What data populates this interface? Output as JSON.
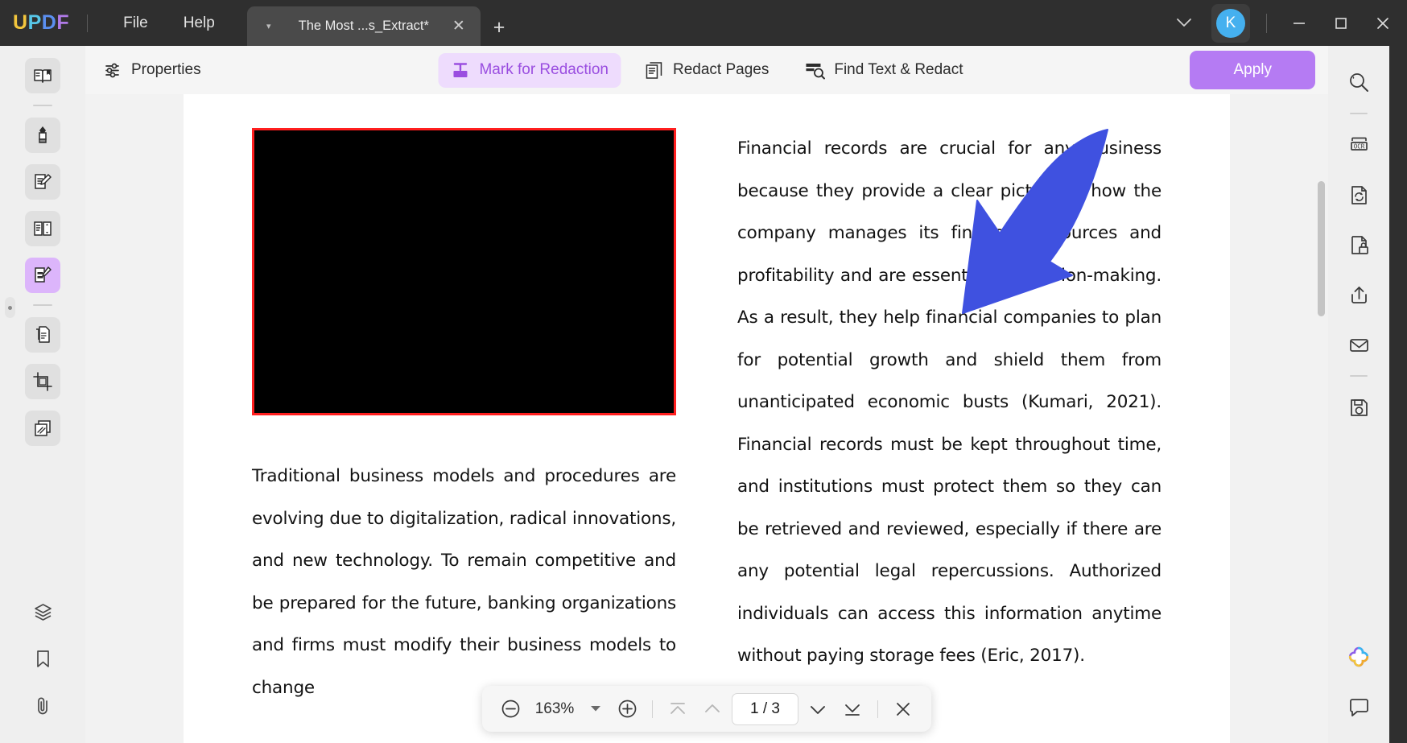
{
  "app": {
    "logo_letters": [
      {
        "ch": "U",
        "color": "#f2c53d"
      },
      {
        "ch": "P",
        "color": "#57c7e8"
      },
      {
        "ch": "D",
        "color": "#5b8ff0"
      },
      {
        "ch": "F",
        "color": "#b07ae8"
      }
    ],
    "accent": "#b57bf3",
    "redaction_accent": "#9a4ee0"
  },
  "titlebar": {
    "menus": [
      {
        "label": "File",
        "name": "menu-file"
      },
      {
        "label": "Help",
        "name": "menu-help"
      }
    ],
    "tab": {
      "title": "The Most ...s_Extract*",
      "caret": "▾",
      "close": "✕"
    },
    "new_tab": "+",
    "chevron_down": "⌄",
    "avatar_initial": "K",
    "window_controls": {
      "minimize": "—",
      "maximize": "▢",
      "close": "✕"
    }
  },
  "left_rail": {
    "items": [
      {
        "name": "sidebar-reader-icon",
        "icon": "book-reader-icon",
        "boxed": true,
        "active": false
      },
      {
        "name": "sidebar-annotate-icon",
        "icon": "highlighter-pen-icon",
        "boxed": true,
        "active": false
      },
      {
        "name": "sidebar-edit-pdf-icon",
        "icon": "edit-document-icon",
        "boxed": true,
        "active": false
      },
      {
        "name": "sidebar-organize-pages-icon",
        "icon": "organize-pages-icon",
        "boxed": true,
        "active": false
      },
      {
        "name": "sidebar-redact-icon",
        "icon": "redact-document-icon",
        "boxed": false,
        "active": true
      },
      {
        "name": "sidebar-compare-icon",
        "icon": "compare-documents-icon",
        "boxed": true,
        "active": false
      },
      {
        "name": "sidebar-crop-icon",
        "icon": "crop-page-icon",
        "boxed": true,
        "active": false
      },
      {
        "name": "sidebar-batch-icon",
        "icon": "batch-process-icon",
        "boxed": true,
        "active": false
      }
    ],
    "bottom_items": [
      {
        "name": "sidebar-layers-icon",
        "icon": "layers-icon"
      },
      {
        "name": "sidebar-bookmarks-icon",
        "icon": "bookmark-icon"
      },
      {
        "name": "sidebar-attachments-icon",
        "icon": "attachment-clip-icon"
      }
    ]
  },
  "toolbar": {
    "properties_label": "Properties",
    "properties_icon": "sliders-settings-icon",
    "center_tools": [
      {
        "label": "Mark for Redaction",
        "name": "tool-mark-for-redaction",
        "icon": "redaction-text-icon",
        "selected": true
      },
      {
        "label": "Redact Pages",
        "name": "tool-redact-pages",
        "icon": "pages-stack-icon",
        "selected": false
      },
      {
        "label": "Find Text & Redact",
        "name": "tool-find-text-and-redact",
        "icon": "find-text-search-icon",
        "selected": false
      }
    ],
    "apply_label": "Apply"
  },
  "document": {
    "redaction_block_label": "redacted-content-block",
    "left_column_paragraph": "Traditional business models and procedures are evolving due to digitalization, radical innovations, and new technology. To remain competitive and be prepared for the future, banking organizations and firms must modify their business models to change",
    "right_column_paragraph": "Financial records are crucial for any business because they provide a clear picture of how the company manages its financial resources and profitability and are essential to decision-making. As a result, they help financial companies to plan for potential growth and shield them from unanticipated economic busts (Kumari, 2021). Financial records must be kept throughout time, and institutions must protect them so they can be retrieved and reviewed, especially if there are any potential legal repercussions. Authorized individuals can access this information anytime without paying storage fees (Eric, 2017)."
  },
  "zoombar": {
    "zoom_out": "zoom-out-icon",
    "zoom_level": "163%",
    "caret": "▾",
    "zoom_in": "zoom-in-icon",
    "first_page": "first-page-icon",
    "prev_page": "previous-page-icon",
    "page_indicator": "1 / 3",
    "next_page": "next-page-icon",
    "last_page": "last-page-icon",
    "close": "✕"
  },
  "right_rail": {
    "items": [
      {
        "name": "right-search-icon",
        "icon": "search-magnifier-icon"
      },
      {
        "sep": true
      },
      {
        "name": "right-ocr-icon",
        "icon": "ocr-icon"
      },
      {
        "name": "right-convert-icon",
        "icon": "convert-document-icon"
      },
      {
        "name": "right-protect-icon",
        "icon": "protect-lock-document-icon"
      },
      {
        "name": "right-share-icon",
        "icon": "share-upload-icon"
      },
      {
        "name": "right-email-icon",
        "icon": "email-envelope-icon"
      },
      {
        "sep": true
      },
      {
        "name": "right-save-icon",
        "icon": "save-disk-icon"
      }
    ],
    "bottom_items": [
      {
        "name": "right-ai-assistant-icon",
        "icon": "ai-sparkle-flower-icon"
      },
      {
        "name": "right-comments-icon",
        "icon": "comment-bubble-icon"
      }
    ]
  }
}
